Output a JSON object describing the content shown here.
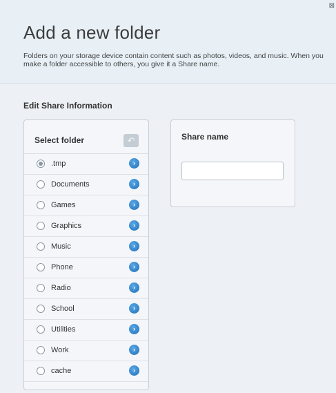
{
  "dialog": {
    "title": "Add a new folder",
    "description": "Folders on your storage device contain content such as photos, videos, and music. When you make a folder accessible to others, you give it a Share name.",
    "close_glyph": "⊠"
  },
  "edit_section": {
    "title": "Edit Share Information"
  },
  "folder_panel": {
    "header": "Select folder",
    "back_glyph": "↶",
    "arrow_glyph": "›",
    "items": [
      {
        "label": ".tmp",
        "selected": true
      },
      {
        "label": "Documents",
        "selected": false
      },
      {
        "label": "Games",
        "selected": false
      },
      {
        "label": "Graphics",
        "selected": false
      },
      {
        "label": "Music",
        "selected": false
      },
      {
        "label": "Phone",
        "selected": false
      },
      {
        "label": "Radio",
        "selected": false
      },
      {
        "label": "School",
        "selected": false
      },
      {
        "label": "Utilities",
        "selected": false
      },
      {
        "label": "Work",
        "selected": false
      },
      {
        "label": "cache",
        "selected": false
      }
    ]
  },
  "share_panel": {
    "label": "Share name",
    "value": "",
    "placeholder": ""
  },
  "colors": {
    "accent": "#2b7fc9",
    "header_bg": "#e8f0f6",
    "page_bg": "#edf0f4"
  }
}
